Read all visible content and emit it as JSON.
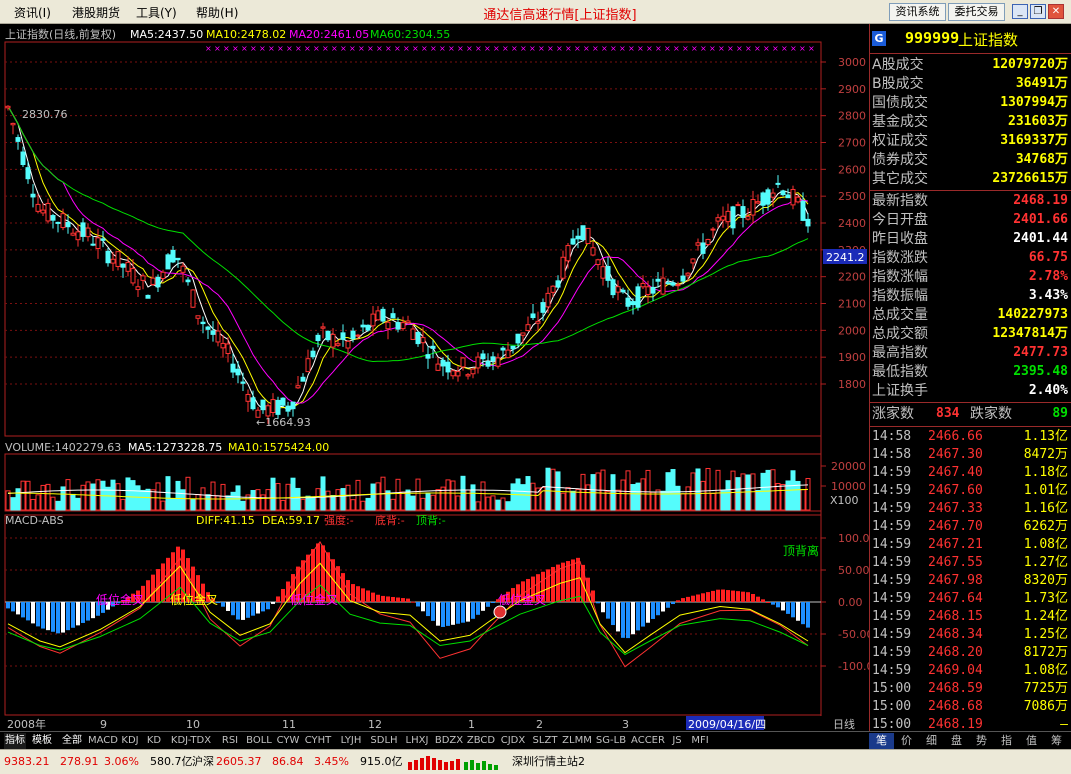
{
  "menubar": {
    "items": [
      "资讯(I)",
      "港股期货",
      "工具(Y)",
      "帮助(H)"
    ],
    "app_title": "通达信高速行情[上证指数]",
    "buttons": [
      "资讯系统",
      "委托交易"
    ],
    "window_controls": [
      "minimize-icon",
      "restore-icon",
      "close-icon"
    ]
  },
  "chart": {
    "header": "上证指数(日线,前复权)",
    "ma5": "MA5:2437.50",
    "ma10": "MA10:2478.02",
    "ma20": "MA20:2461.05",
    "ma60": "MA60:2304.55",
    "high_label": "2830.76",
    "low_label": "←1664.93",
    "current_price_tag": "2241.2",
    "volume_header": "VOLUME:1402279.63",
    "vol_ma5": "MA5:1273228.75",
    "vol_ma10": "MA10:1575424.00",
    "vol_unit": "X100",
    "macd_header": "MACD-ABS",
    "macd_diff": "DIFF:41.15",
    "macd_dea": "DEA:59.17",
    "macd_strength": "强度:-",
    "macd_bottom_div": "底背:-",
    "macd_top_div": "顶背:-",
    "macd_signals": [
      "低位金叉",
      "低位金叉",
      "低位金叉",
      "低位金叉",
      "顶背离"
    ],
    "date_bar": [
      "2008年",
      "9",
      "10",
      "11",
      "12",
      "1",
      "2",
      "3"
    ],
    "cursor_date": "2009/04/16/四",
    "period": "日线",
    "colors": {
      "up": "#ff3232",
      "down": "#54fcfc",
      "ma5": "#ffffff",
      "ma10": "#ffff00",
      "ma20": "#ff00ff",
      "ma60": "#00e000",
      "axis": "#b02020",
      "grid": "#7a1010"
    }
  },
  "chart_data": [
    {
      "type": "line",
      "title": "上证指数(日线,前复权)",
      "xlabel": "",
      "ylabel": "",
      "ylim": [
        1664.93,
        3050
      ],
      "y_ticks": [
        1800,
        1900,
        2000,
        2100,
        2200,
        2300,
        2400,
        2500,
        2600,
        2700,
        2800,
        2900,
        3000
      ],
      "series": [
        {
          "name": "MA5",
          "last": 2437.5
        },
        {
          "name": "MA10",
          "last": 2478.02
        },
        {
          "name": "MA20",
          "last": 2461.05
        },
        {
          "name": "MA60",
          "last": 2304.55
        }
      ],
      "annotations": {
        "high": 2830.76,
        "low": 1664.93
      }
    },
    {
      "type": "bar",
      "title": "VOLUME",
      "y_ticks": [
        10000,
        20000
      ],
      "series": [
        {
          "name": "VOLUME",
          "last": 1402279.63
        },
        {
          "name": "MA5",
          "last": 1273228.75
        },
        {
          "name": "MA10",
          "last": 1575424.0
        }
      ]
    },
    {
      "type": "bar",
      "title": "MACD-ABS",
      "y_ticks": [
        -100,
        -50,
        0,
        50,
        100
      ],
      "series": [
        {
          "name": "DIFF",
          "last": 41.15
        },
        {
          "name": "DEA",
          "last": 59.17
        }
      ]
    }
  ],
  "quote": {
    "code": "999999",
    "name": "上证指数",
    "turnover": [
      {
        "label": "A股成交",
        "value": "12079720万"
      },
      {
        "label": "B股成交",
        "value": "36491万"
      },
      {
        "label": "国债成交",
        "value": "1307994万"
      },
      {
        "label": "基金成交",
        "value": "231603万"
      },
      {
        "label": "权证成交",
        "value": "3169337万"
      },
      {
        "label": "债券成交",
        "value": "34768万"
      },
      {
        "label": "其它成交",
        "value": "23726615万"
      }
    ],
    "stats": [
      {
        "label": "最新指数",
        "value": "2468.19",
        "color": "#ff3232"
      },
      {
        "label": "今日开盘",
        "value": "2401.66",
        "color": "#ff3232"
      },
      {
        "label": "昨日收盘",
        "value": "2401.44",
        "color": "#ffffff"
      },
      {
        "label": "指数涨跌",
        "value": "66.75",
        "color": "#ff3232"
      },
      {
        "label": "指数涨幅",
        "value": "2.78%",
        "color": "#ff3232"
      },
      {
        "label": "指数振幅",
        "value": "3.43%",
        "color": "#ffffff"
      },
      {
        "label": "总成交量",
        "value": "140227973",
        "color": "#ffff00"
      },
      {
        "label": "总成交额",
        "value": "12347814万",
        "color": "#ffff00"
      },
      {
        "label": "最高指数",
        "value": "2477.73",
        "color": "#ff3232"
      },
      {
        "label": "最低指数",
        "value": "2395.48",
        "color": "#00e000"
      },
      {
        "label": "上证换手",
        "value": "2.40%",
        "color": "#ffffff"
      }
    ],
    "up_label": "涨家数",
    "up_count": "834",
    "down_label": "跌家数",
    "down_count": "89"
  },
  "ticks": [
    {
      "time": "14:58",
      "price": "2466.66",
      "vol": "1.13亿"
    },
    {
      "time": "14:58",
      "price": "2467.30",
      "vol": "8472万"
    },
    {
      "time": "14:59",
      "price": "2467.40",
      "vol": "1.18亿"
    },
    {
      "time": "14:59",
      "price": "2467.60",
      "vol": "1.01亿"
    },
    {
      "time": "14:59",
      "price": "2467.33",
      "vol": "1.16亿"
    },
    {
      "time": "14:59",
      "price": "2467.70",
      "vol": "6262万"
    },
    {
      "time": "14:59",
      "price": "2467.21",
      "vol": "1.08亿"
    },
    {
      "time": "14:59",
      "price": "2467.55",
      "vol": "1.27亿"
    },
    {
      "time": "14:59",
      "price": "2467.98",
      "vol": "8320万"
    },
    {
      "time": "14:59",
      "price": "2467.64",
      "vol": "1.73亿"
    },
    {
      "time": "14:59",
      "price": "2468.15",
      "vol": "1.24亿"
    },
    {
      "time": "14:59",
      "price": "2468.34",
      "vol": "1.25亿"
    },
    {
      "time": "14:59",
      "price": "2468.20",
      "vol": "8172万"
    },
    {
      "time": "14:59",
      "price": "2469.04",
      "vol": "1.08亿"
    },
    {
      "time": "15:00",
      "price": "2468.59",
      "vol": "7725万"
    },
    {
      "time": "15:00",
      "price": "2468.68",
      "vol": "7086万"
    },
    {
      "time": "15:00",
      "price": "2468.19",
      "vol": "—"
    }
  ],
  "indicator_tabs": [
    "指标",
    "模板",
    "全部",
    "MACD",
    "KDJ",
    "KD",
    "KDJ-TDX",
    "RSI",
    "BOLL",
    "CYW",
    "CYHT",
    "LYJH",
    "SDLH",
    "LHXJ",
    "BDZX",
    "ZBCD",
    "CJDX",
    "SLZT",
    "ZLMM",
    "SG-LB",
    "ACCER",
    "JS",
    "MFI"
  ],
  "right_tabs": [
    "笔",
    "价",
    "细",
    "盘",
    "势",
    "指",
    "值",
    "筹"
  ],
  "status": {
    "sh_index": "9383.21",
    "sh_change": "278.91",
    "sh_pct": "3.06%",
    "sh_amount": "580.7亿",
    "sz_label": "沪深",
    "sz_index": "2605.37",
    "sz_change": "86.84",
    "sz_pct": "3.45%",
    "sz_amount": "915.0亿",
    "server": "深圳行情主站2"
  }
}
